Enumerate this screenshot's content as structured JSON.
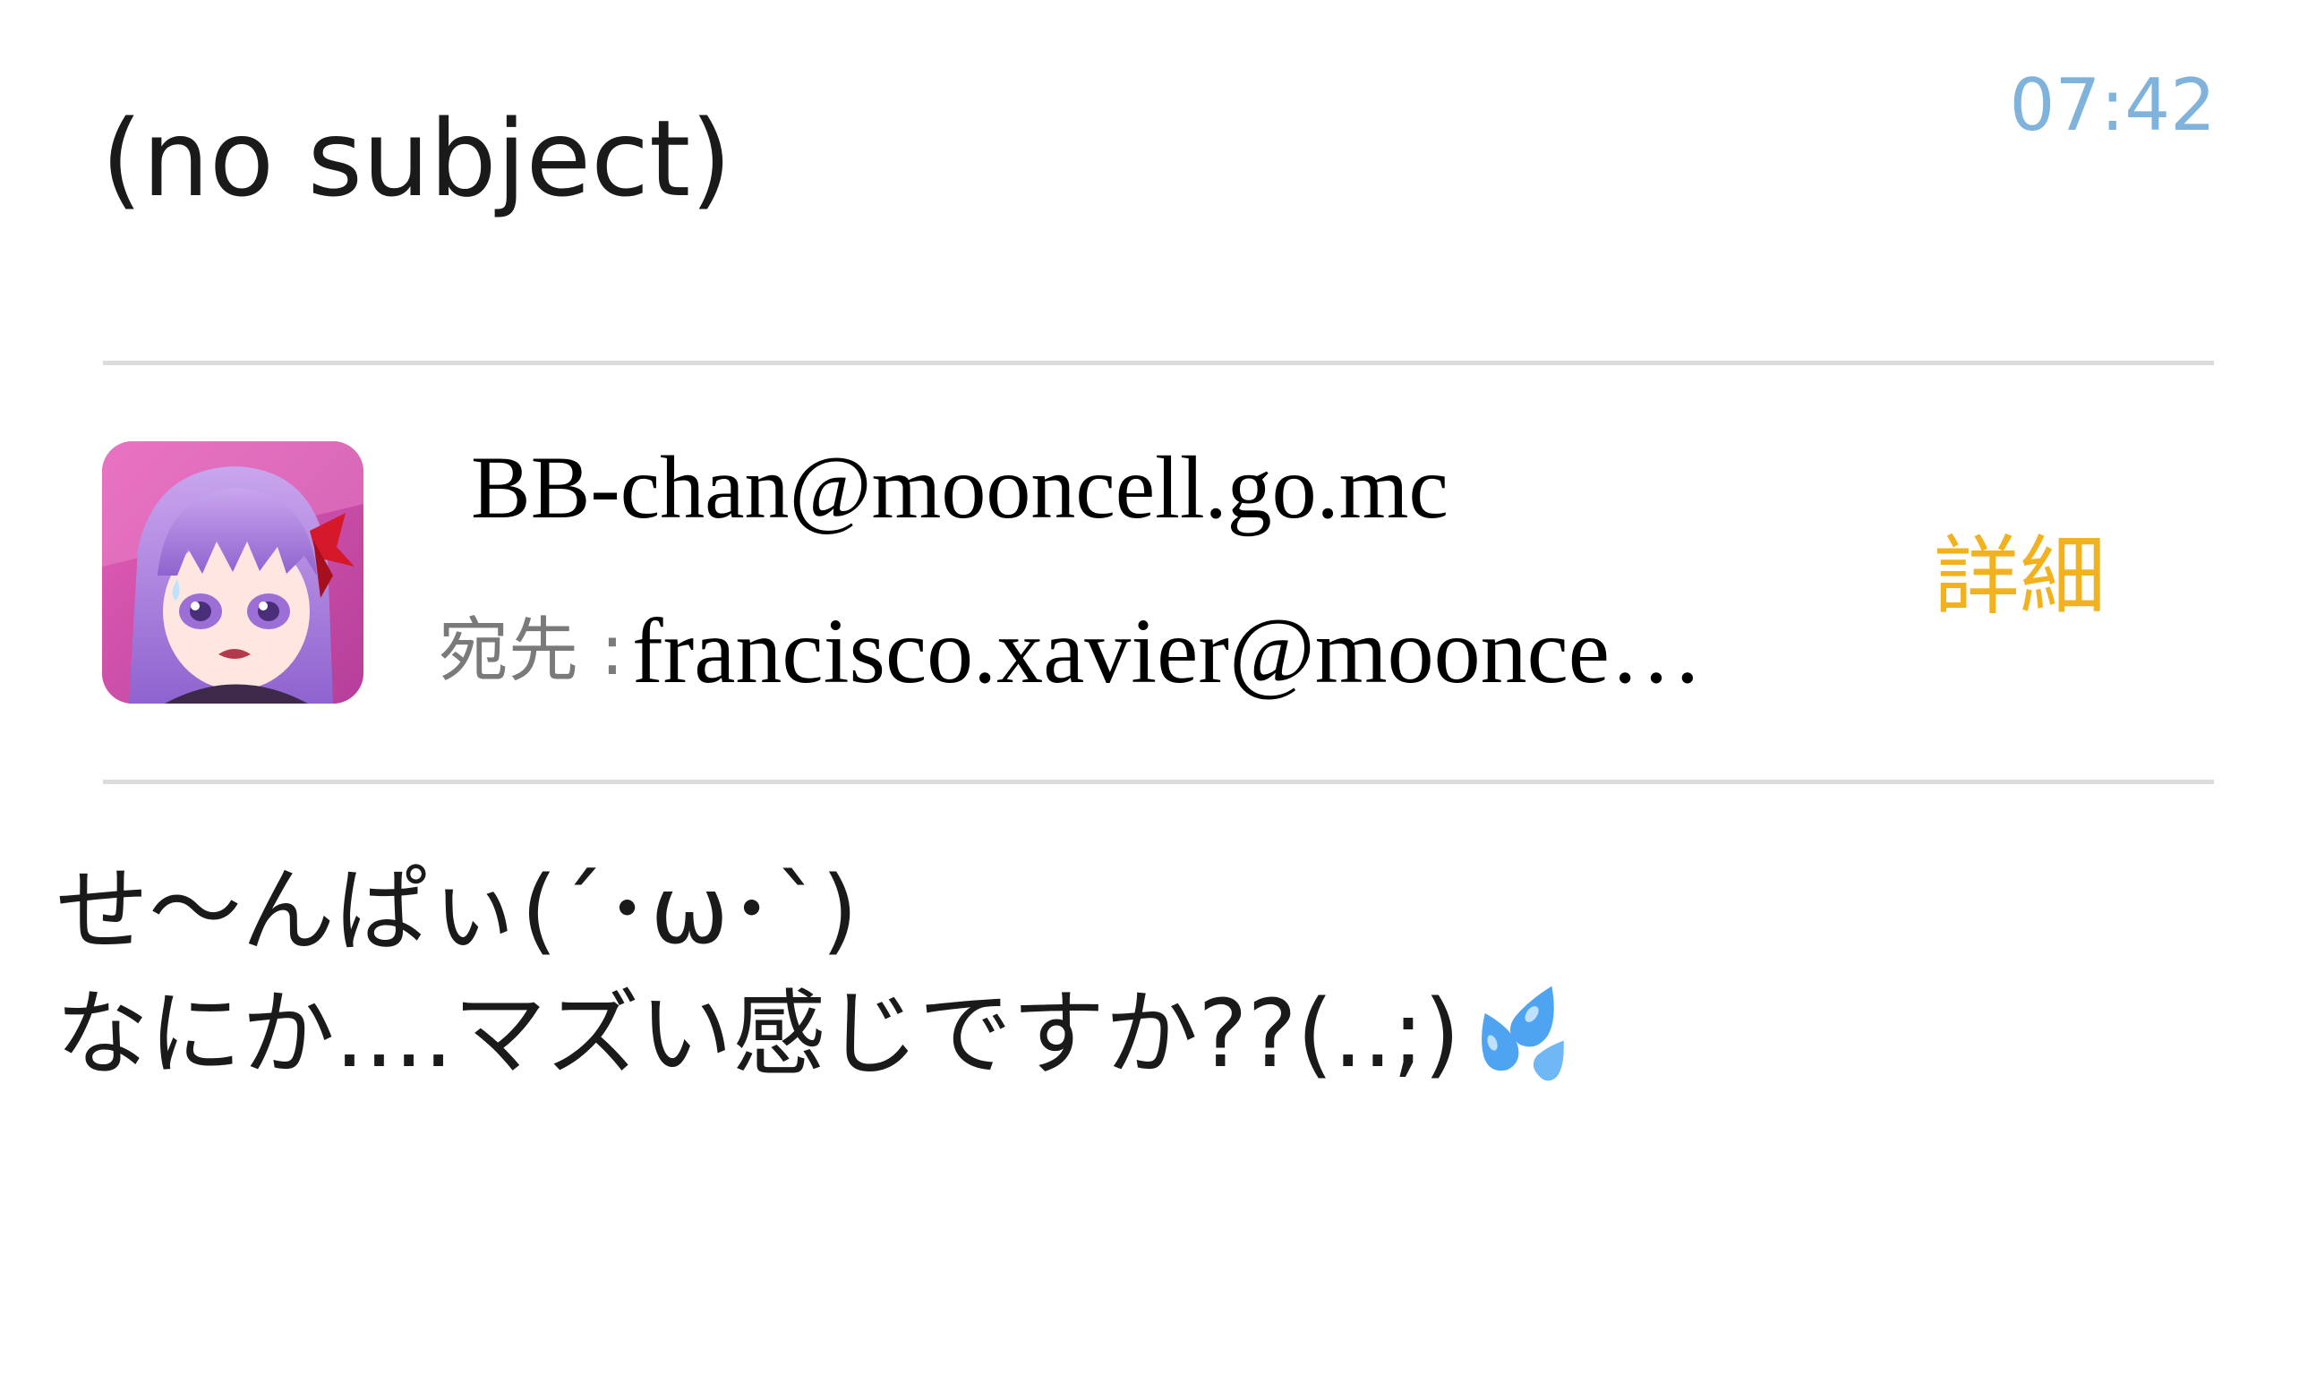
{
  "header": {
    "subject": "(no subject)",
    "time": "07:42"
  },
  "sender": {
    "email": "BB-chan@mooncell.go.mc",
    "avatar_icon": "avatar-icon"
  },
  "recipient": {
    "label": "宛先 :",
    "email": "francisco.xavier@moonce…"
  },
  "actions": {
    "details_label": "詳細"
  },
  "body": {
    "line1": "せ〜んぱぃ(´･ω･`)",
    "line2": "なにか....マズい感じですか??(..;)",
    "trailing_icon": "sweat-droplets-icon"
  },
  "colors": {
    "time": "#7fb3dc",
    "details": "#f2b21f",
    "divider": "#dcdcdc",
    "label": "#7a7a7a"
  }
}
